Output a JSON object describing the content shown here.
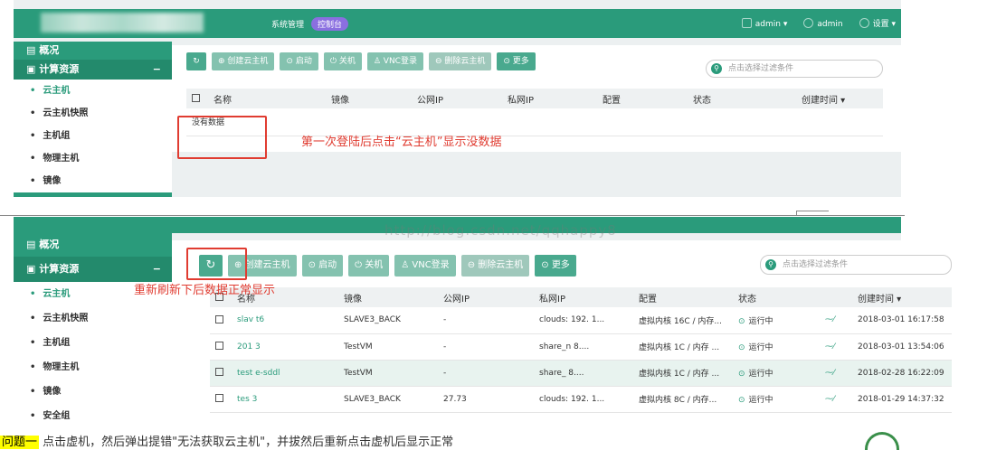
{
  "header": {
    "nav_label": "系统管理",
    "console_badge": "控制台",
    "user_label": "admin",
    "user_label2": "admin",
    "settings_label": "设置"
  },
  "sidebar": {
    "overview": "概况",
    "compute": "计算资源",
    "collapse": "−",
    "items": [
      "云主机",
      "云主机快照",
      "主机组",
      "物理主机",
      "镜像",
      "安全组"
    ]
  },
  "toolbar": {
    "refresh": "↻",
    "create": "创建云主机",
    "start": "启动",
    "shutdown": "关机",
    "vnc": "VNC登录",
    "delete": "删除云主机",
    "more": "更多",
    "search_placeholder": "点击选择过滤条件"
  },
  "table": {
    "columns": [
      "名称",
      "镜像",
      "公网IP",
      "私网IP",
      "配置",
      "状态",
      "创建时间"
    ],
    "empty_text": "没有数据",
    "rows": [
      {
        "name": "slav      t6",
        "image": "SLAVE3_BACK",
        "public_ip": "-",
        "private_ip": "clouds: 192.        1...",
        "config": "虚拟内核 16C / 内存...",
        "status": "运行中",
        "created": "2018-03-01 16:17:58"
      },
      {
        "name": "201        3",
        "image": "TestVM",
        "public_ip": "-",
        "private_ip": "share_n          8....",
        "config": "虚拟内核 1C / 内存 ...",
        "status": "运行中",
        "created": "2018-03-01 13:54:06"
      },
      {
        "name": "test         e-sddl",
        "image": "TestVM",
        "public_ip": "-",
        "private_ip": "share_          8....",
        "config": "虚拟内核 1C / 内存 ...",
        "status": "运行中",
        "created": "2018-02-28 16:22:09"
      },
      {
        "name": "tes         3",
        "image": "SLAVE3_BACK",
        "public_ip": "     27.73",
        "private_ip": "clouds: 192.        1...",
        "config": "虚拟内核 8C / 内存...",
        "status": "运行中",
        "created": "2018-01-29 14:37:32"
      }
    ]
  },
  "annotations": {
    "first": "第一次登陆后点击“云主机”显示没数据",
    "second": "重新刷新下后数据正常显示",
    "watermark": "http://blog.csdn.net/qqhappy8"
  },
  "caption": {
    "highlight": "问题一",
    "text": "点击虚机，然后弹出提错\"无法获取云主机\"，并拔然后重新点击虚机后显示正常"
  },
  "colors": {
    "brand": "#2a9b7b",
    "annotation": "#e03c31"
  }
}
